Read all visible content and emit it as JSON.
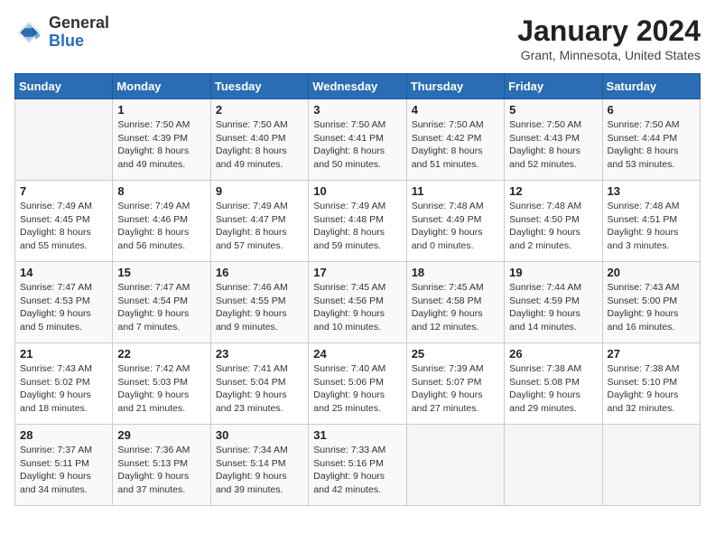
{
  "header": {
    "logo": {
      "general": "General",
      "blue": "Blue"
    },
    "title": "January 2024",
    "location": "Grant, Minnesota, United States"
  },
  "calendar": {
    "days_of_week": [
      "Sunday",
      "Monday",
      "Tuesday",
      "Wednesday",
      "Thursday",
      "Friday",
      "Saturday"
    ],
    "weeks": [
      [
        {
          "day": "",
          "info": ""
        },
        {
          "day": "1",
          "info": "Sunrise: 7:50 AM\nSunset: 4:39 PM\nDaylight: 8 hours\nand 49 minutes."
        },
        {
          "day": "2",
          "info": "Sunrise: 7:50 AM\nSunset: 4:40 PM\nDaylight: 8 hours\nand 49 minutes."
        },
        {
          "day": "3",
          "info": "Sunrise: 7:50 AM\nSunset: 4:41 PM\nDaylight: 8 hours\nand 50 minutes."
        },
        {
          "day": "4",
          "info": "Sunrise: 7:50 AM\nSunset: 4:42 PM\nDaylight: 8 hours\nand 51 minutes."
        },
        {
          "day": "5",
          "info": "Sunrise: 7:50 AM\nSunset: 4:43 PM\nDaylight: 8 hours\nand 52 minutes."
        },
        {
          "day": "6",
          "info": "Sunrise: 7:50 AM\nSunset: 4:44 PM\nDaylight: 8 hours\nand 53 minutes."
        }
      ],
      [
        {
          "day": "7",
          "info": "Sunrise: 7:49 AM\nSunset: 4:45 PM\nDaylight: 8 hours\nand 55 minutes."
        },
        {
          "day": "8",
          "info": "Sunrise: 7:49 AM\nSunset: 4:46 PM\nDaylight: 8 hours\nand 56 minutes."
        },
        {
          "day": "9",
          "info": "Sunrise: 7:49 AM\nSunset: 4:47 PM\nDaylight: 8 hours\nand 57 minutes."
        },
        {
          "day": "10",
          "info": "Sunrise: 7:49 AM\nSunset: 4:48 PM\nDaylight: 8 hours\nand 59 minutes."
        },
        {
          "day": "11",
          "info": "Sunrise: 7:48 AM\nSunset: 4:49 PM\nDaylight: 9 hours\nand 0 minutes."
        },
        {
          "day": "12",
          "info": "Sunrise: 7:48 AM\nSunset: 4:50 PM\nDaylight: 9 hours\nand 2 minutes."
        },
        {
          "day": "13",
          "info": "Sunrise: 7:48 AM\nSunset: 4:51 PM\nDaylight: 9 hours\nand 3 minutes."
        }
      ],
      [
        {
          "day": "14",
          "info": "Sunrise: 7:47 AM\nSunset: 4:53 PM\nDaylight: 9 hours\nand 5 minutes."
        },
        {
          "day": "15",
          "info": "Sunrise: 7:47 AM\nSunset: 4:54 PM\nDaylight: 9 hours\nand 7 minutes."
        },
        {
          "day": "16",
          "info": "Sunrise: 7:46 AM\nSunset: 4:55 PM\nDaylight: 9 hours\nand 9 minutes."
        },
        {
          "day": "17",
          "info": "Sunrise: 7:45 AM\nSunset: 4:56 PM\nDaylight: 9 hours\nand 10 minutes."
        },
        {
          "day": "18",
          "info": "Sunrise: 7:45 AM\nSunset: 4:58 PM\nDaylight: 9 hours\nand 12 minutes."
        },
        {
          "day": "19",
          "info": "Sunrise: 7:44 AM\nSunset: 4:59 PM\nDaylight: 9 hours\nand 14 minutes."
        },
        {
          "day": "20",
          "info": "Sunrise: 7:43 AM\nSunset: 5:00 PM\nDaylight: 9 hours\nand 16 minutes."
        }
      ],
      [
        {
          "day": "21",
          "info": "Sunrise: 7:43 AM\nSunset: 5:02 PM\nDaylight: 9 hours\nand 18 minutes."
        },
        {
          "day": "22",
          "info": "Sunrise: 7:42 AM\nSunset: 5:03 PM\nDaylight: 9 hours\nand 21 minutes."
        },
        {
          "day": "23",
          "info": "Sunrise: 7:41 AM\nSunset: 5:04 PM\nDaylight: 9 hours\nand 23 minutes."
        },
        {
          "day": "24",
          "info": "Sunrise: 7:40 AM\nSunset: 5:06 PM\nDaylight: 9 hours\nand 25 minutes."
        },
        {
          "day": "25",
          "info": "Sunrise: 7:39 AM\nSunset: 5:07 PM\nDaylight: 9 hours\nand 27 minutes."
        },
        {
          "day": "26",
          "info": "Sunrise: 7:38 AM\nSunset: 5:08 PM\nDaylight: 9 hours\nand 29 minutes."
        },
        {
          "day": "27",
          "info": "Sunrise: 7:38 AM\nSunset: 5:10 PM\nDaylight: 9 hours\nand 32 minutes."
        }
      ],
      [
        {
          "day": "28",
          "info": "Sunrise: 7:37 AM\nSunset: 5:11 PM\nDaylight: 9 hours\nand 34 minutes."
        },
        {
          "day": "29",
          "info": "Sunrise: 7:36 AM\nSunset: 5:13 PM\nDaylight: 9 hours\nand 37 minutes."
        },
        {
          "day": "30",
          "info": "Sunrise: 7:34 AM\nSunset: 5:14 PM\nDaylight: 9 hours\nand 39 minutes."
        },
        {
          "day": "31",
          "info": "Sunrise: 7:33 AM\nSunset: 5:16 PM\nDaylight: 9 hours\nand 42 minutes."
        },
        {
          "day": "",
          "info": ""
        },
        {
          "day": "",
          "info": ""
        },
        {
          "day": "",
          "info": ""
        }
      ]
    ]
  }
}
